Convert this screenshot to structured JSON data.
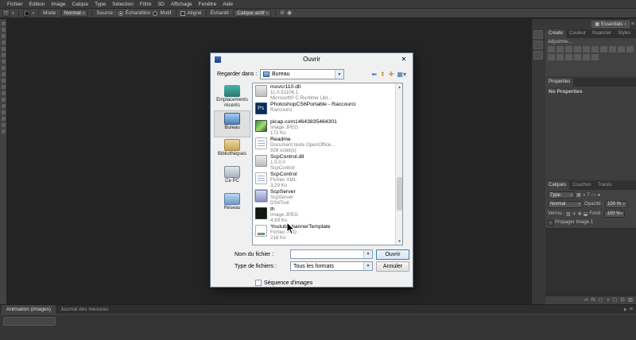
{
  "menu_bar": {
    "items": [
      "Fichier",
      "Edition",
      "Image",
      "Calque",
      "Type",
      "Sélection",
      "Filtre",
      "3D",
      "Affichage",
      "Fenêtre",
      "Aide"
    ]
  },
  "options_bar": {
    "mode_label": "Mode :",
    "mode_value": "Normal",
    "source_label": "Source :",
    "sample_radio": "Échantillon",
    "pattern_radio": "Motif",
    "aligned_checkbox": "Aligné",
    "sample_label": "Échantil :",
    "sample_value": "Calque actif"
  },
  "workspace": {
    "label": "Essentials"
  },
  "right_panel": {
    "top_tabs": [
      "Create",
      "Couleur",
      "Nuancier",
      "Styles"
    ],
    "adjustments_label": "Adjustme...",
    "properties_tab": "Properties",
    "properties_empty": "No Properties",
    "layers": {
      "tabs": [
        "Calques",
        "Couches",
        "Tracés"
      ],
      "filter_value": "Type",
      "blend_value": "Normal",
      "opacity_label": "Opacité :",
      "opacity_value": "100 %",
      "lock_label": "Verrou :",
      "fill_label": "Fond :",
      "fill_value": "100 %",
      "propagate_label": "Propager Image 1"
    }
  },
  "bottom_bar": {
    "tabs": [
      "Animation (images)",
      "Journal des mesures"
    ]
  },
  "dialog": {
    "title": "Ouvrir",
    "look_in_label": "Regarder dans :",
    "look_in_value": "Bureau",
    "sidebar": [
      {
        "label": "Emplacements récents"
      },
      {
        "label": "Bureau"
      },
      {
        "label": "Bibliothèques"
      },
      {
        "label": "Ce PC"
      },
      {
        "label": "Réseau"
      }
    ],
    "files": [
      {
        "name": "movcr110.dll",
        "detail1": "11.0.51106.1",
        "detail2": "Microsoft® C Runtime Libr..."
      },
      {
        "name": "PhotoshopCS6Portable - Raccourci",
        "detail1": "Raccourci",
        "detail2": ""
      },
      {
        "name": "picap.com14643835464301",
        "detail1": "Image JPEG",
        "detail2": "172 Ko"
      },
      {
        "name": "Readme",
        "detail1": "Document texte OpenOffice...",
        "detail2": "928 octet(s)"
      },
      {
        "name": "ScpControl.dll",
        "detail1": "1.0.0.0",
        "detail2": "ScpControl"
      },
      {
        "name": "ScpControl",
        "detail1": "Fichier XML",
        "detail2": "3,29 Ko"
      },
      {
        "name": "ScpServer",
        "detail1": "ScpServer",
        "detail2": "DS4Tool"
      },
      {
        "name": "th",
        "detail1": "Image JPEG",
        "detail2": "4,99 Ko"
      },
      {
        "name": "Youtube-bannerTemplate",
        "detail1": "Fichier PSD",
        "detail2": "218 Ko"
      }
    ],
    "file_name_label": "Nom du fichier :",
    "file_name_value": "",
    "file_type_label": "Type de fichiers :",
    "file_type_value": "Tous les formats",
    "open_button": "Ouvrir",
    "cancel_button": "Annuler",
    "sequence_label": "Séquence d'images"
  }
}
